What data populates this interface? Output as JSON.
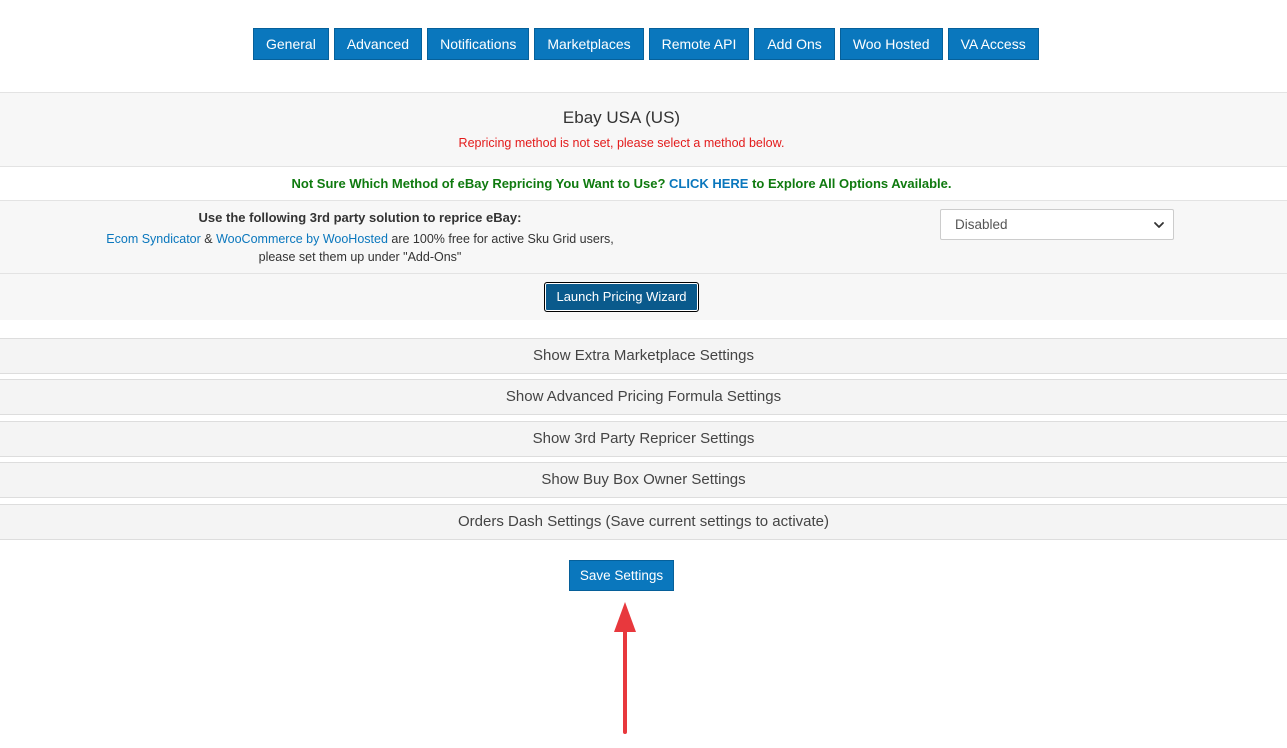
{
  "tabs": [
    "General",
    "Advanced",
    "Notifications",
    "Marketplaces",
    "Remote API",
    "Add Ons",
    "Woo Hosted",
    "VA Access"
  ],
  "marketplace": {
    "title": "Ebay USA (US)",
    "warning": "Repricing method is not set, please select a method below."
  },
  "notice": {
    "prefix": "Not Sure Which Method of eBay Repricing You Want to Use? ",
    "link": "CLICK HERE",
    "suffix": " to Explore All Options Available."
  },
  "third_party": {
    "heading": "Use the following 3rd party solution to reprice eBay:",
    "link1": "Ecom Syndicator",
    "amp": " & ",
    "link2": "WooCommerce by WooHosted",
    "line1_rest": " are 100% free for active Sku Grid users,",
    "line2": "please set them up under \"Add-Ons\""
  },
  "select": {
    "value": "Disabled"
  },
  "wizard_label": "Launch Pricing Wizard",
  "accordions": [
    "Show Extra Marketplace Settings",
    "Show Advanced Pricing Formula Settings",
    "Show 3rd Party Repricer Settings",
    "Show Buy Box Owner Settings",
    "Orders Dash Settings (Save current settings to activate)"
  ],
  "save_label": "Save Settings",
  "colors": {
    "primary": "#0a77bd",
    "warning": "#e31b1b",
    "notice": "#0f7a0f",
    "arrow": "#e8383d"
  }
}
